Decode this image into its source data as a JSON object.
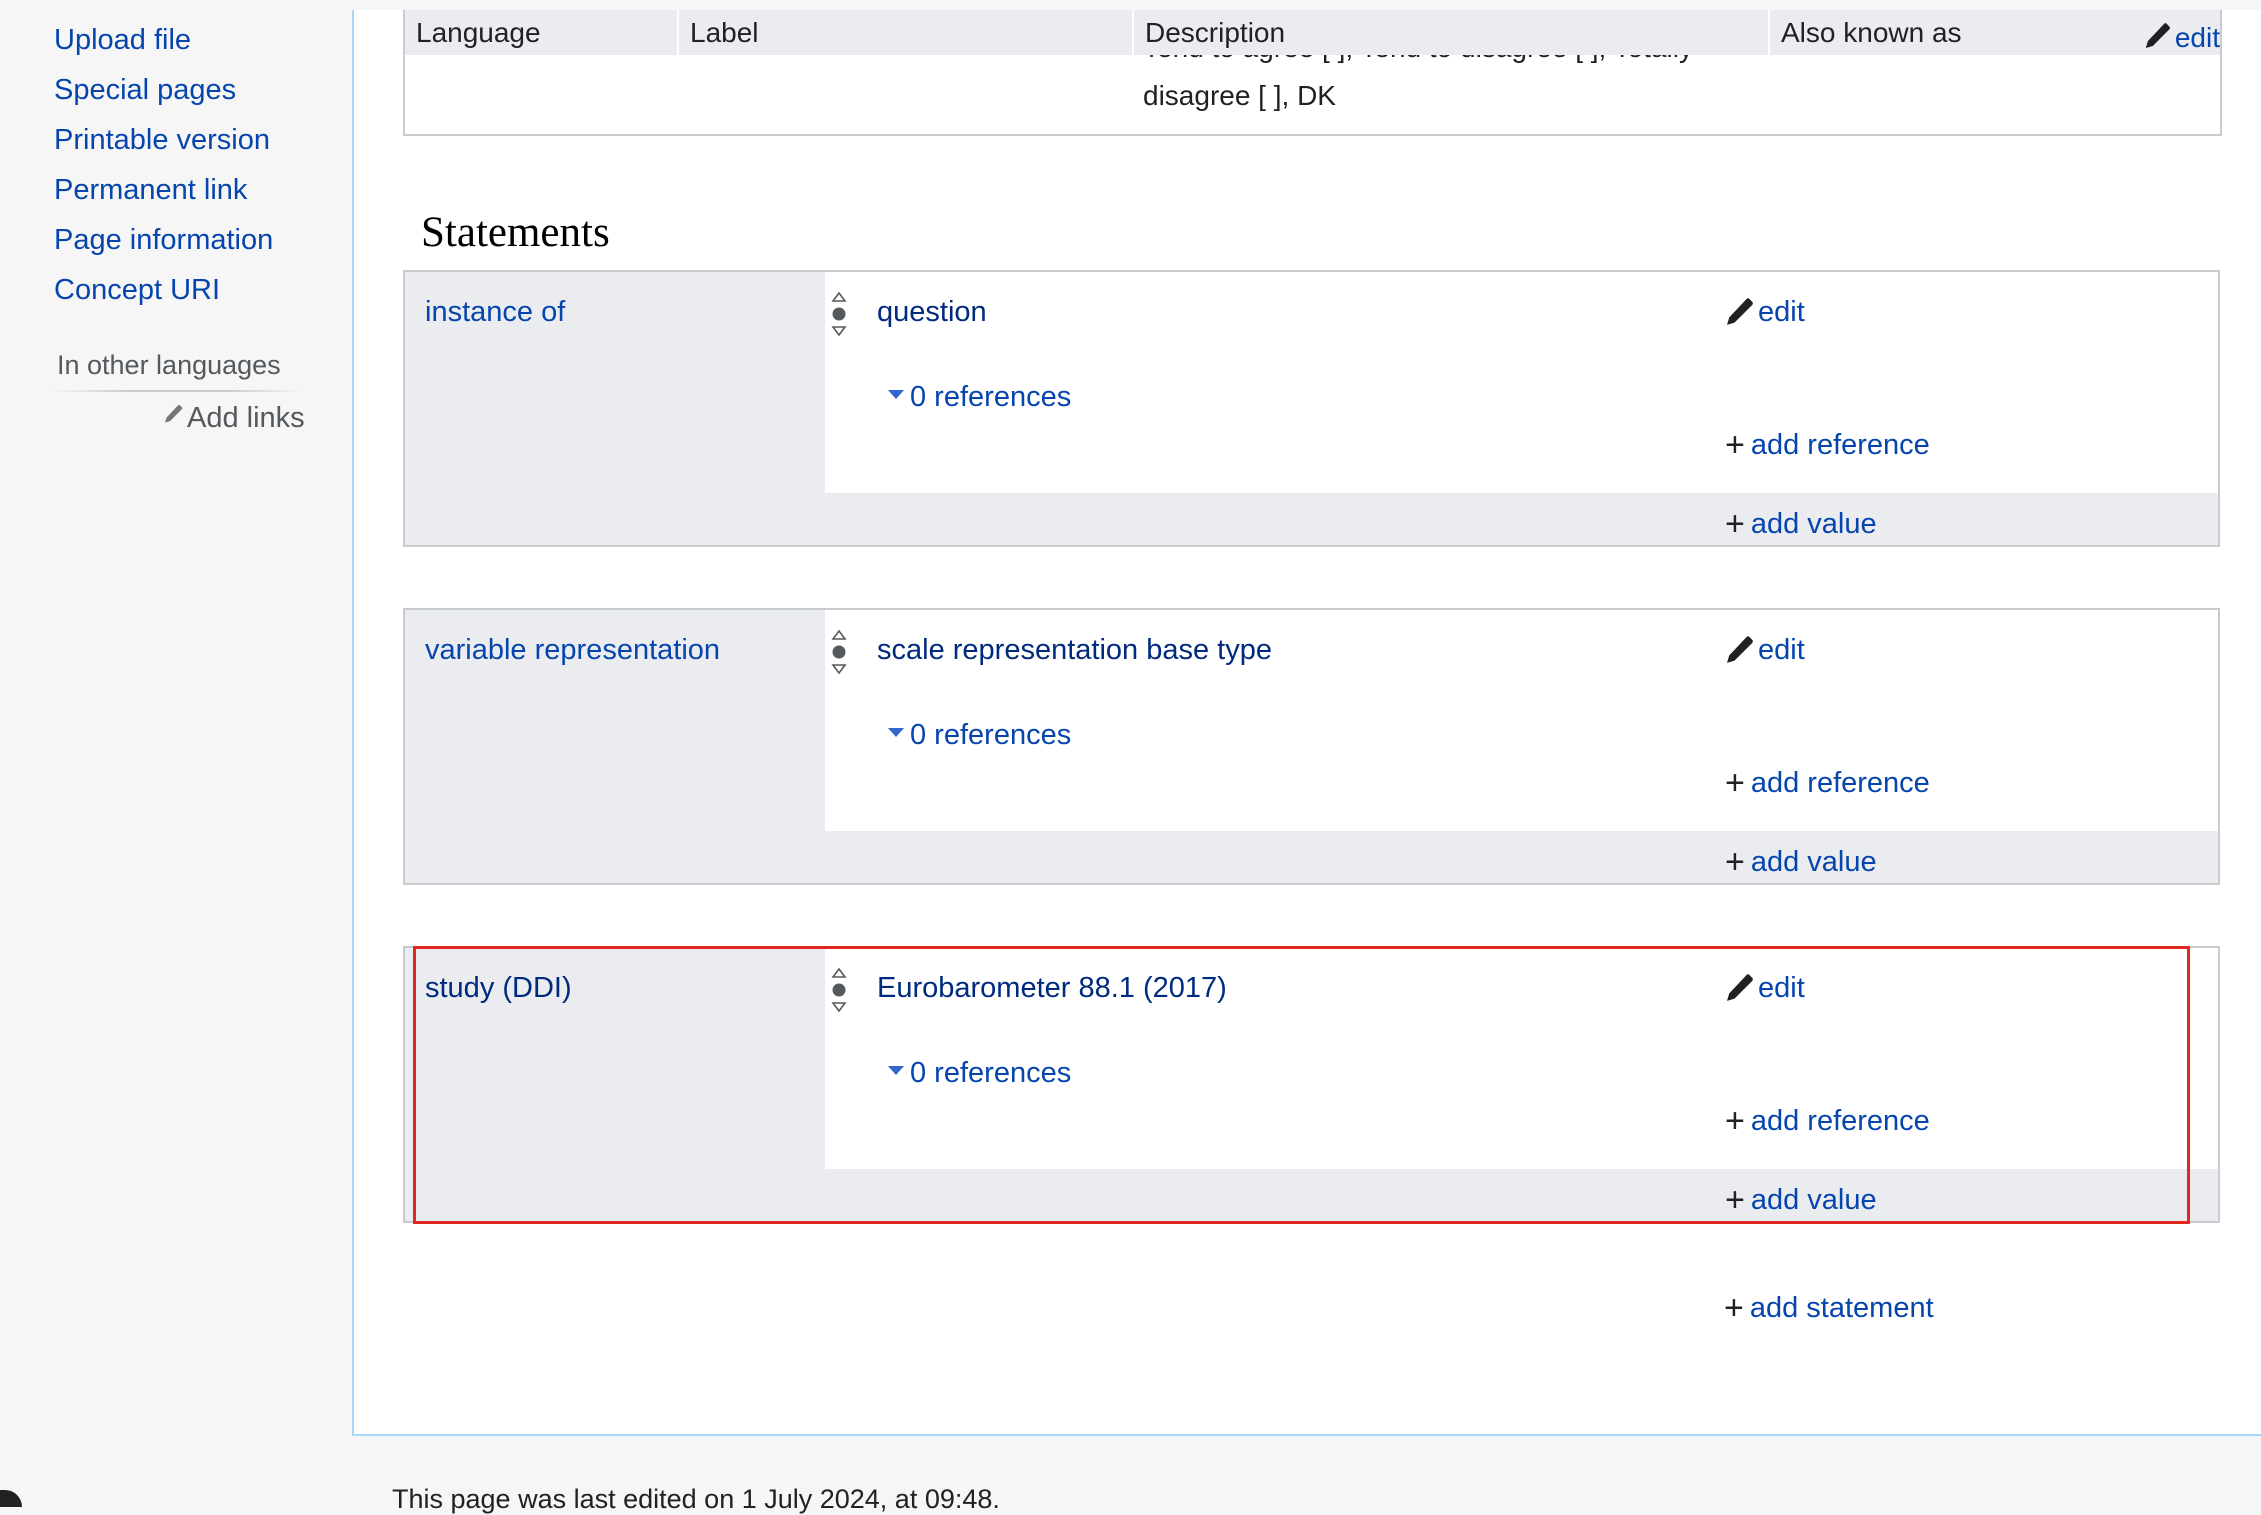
{
  "sidebar": {
    "tools": [
      "Upload file",
      "Special pages",
      "Printable version",
      "Permanent link",
      "Page information",
      "Concept URI"
    ],
    "languages_heading": "In other languages",
    "add_links": "Add links",
    "add_links_icon": "pencil-icon"
  },
  "termbox": {
    "columns": [
      "Language",
      "Label",
      "Description",
      "Also known as"
    ],
    "description_partial": "Tend to agree [ ], Tend to disagree [ ], Totally",
    "description_last": "disagree [ ], DK",
    "edit_label": "edit"
  },
  "statements": {
    "heading": "Statements",
    "groups": [
      {
        "property": "instance of",
        "value": "question",
        "references": "0 references",
        "edit": "edit",
        "add_reference": "add reference",
        "add_value": "add value"
      },
      {
        "property": "variable representation",
        "value": "scale representation base type",
        "references": "0 references",
        "edit": "edit",
        "add_reference": "add reference",
        "add_value": "add value"
      },
      {
        "property": "study (DDI)",
        "value": "Eurobarometer 88.1 (2017)",
        "references": "0 references",
        "edit": "edit",
        "add_reference": "add reference",
        "add_value": "add value"
      }
    ],
    "add_statement": "add statement"
  },
  "footer": {
    "last_edited": "This page was last edited on 1 July 2024, at 09:48."
  },
  "colors": {
    "link": "#0645ad",
    "value_link": "#002a7e",
    "border": "#c8ccd1",
    "group_bg": "#eaecf0",
    "highlight": "#e0281e"
  }
}
